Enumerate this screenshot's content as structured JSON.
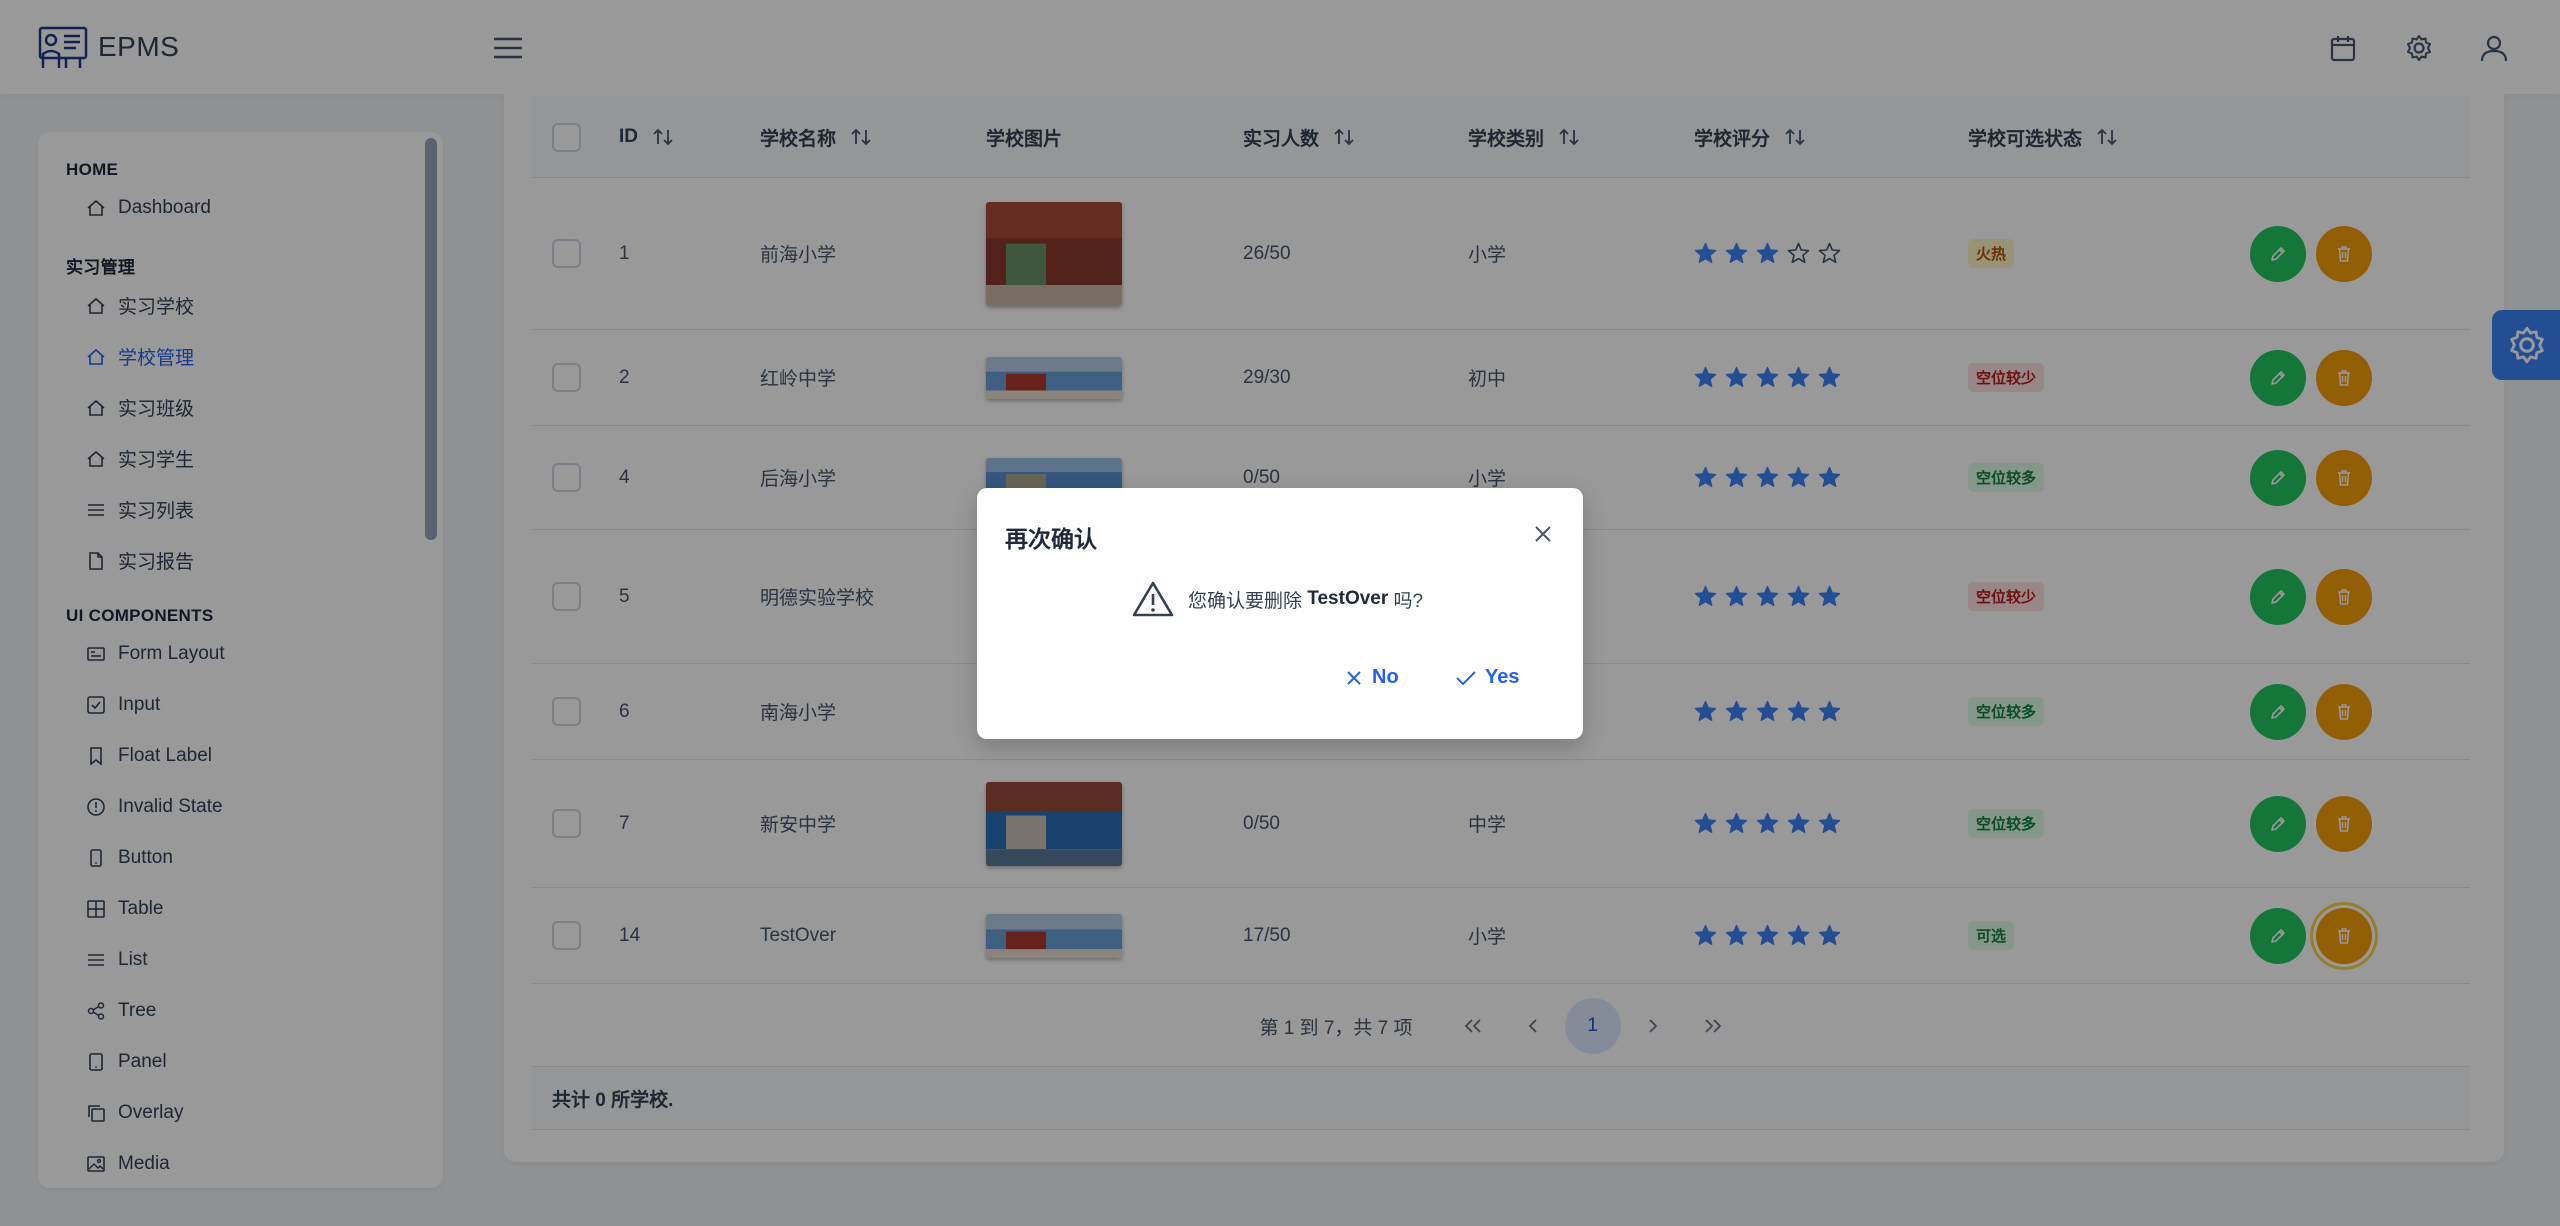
{
  "app": {
    "name": "EPMS"
  },
  "topbar_icons": [
    "calendar-icon",
    "gear-icon",
    "user-icon"
  ],
  "sidebar": {
    "sections": [
      {
        "title": "HOME",
        "items": [
          {
            "label": "Dashboard",
            "icon": "home-icon"
          }
        ]
      },
      {
        "title": "实习管理",
        "items": [
          {
            "label": "实习学校",
            "icon": "home-icon"
          },
          {
            "label": "学校管理",
            "icon": "home-icon",
            "active": true
          },
          {
            "label": "实习班级",
            "icon": "home-icon"
          },
          {
            "label": "实习学生",
            "icon": "home-icon"
          },
          {
            "label": "实习列表",
            "icon": "list-icon"
          },
          {
            "label": "实习报告",
            "icon": "file-icon"
          }
        ]
      },
      {
        "title": "UI COMPONENTS",
        "items": [
          {
            "label": "Form Layout",
            "icon": "id-card-icon"
          },
          {
            "label": "Input",
            "icon": "check-square-icon"
          },
          {
            "label": "Float Label",
            "icon": "bookmark-icon"
          },
          {
            "label": "Invalid State",
            "icon": "exclamation-circle-icon"
          },
          {
            "label": "Button",
            "icon": "mobile-icon"
          },
          {
            "label": "Table",
            "icon": "table-icon"
          },
          {
            "label": "List",
            "icon": "list-icon"
          },
          {
            "label": "Tree",
            "icon": "share-icon"
          },
          {
            "label": "Panel",
            "icon": "tablet-icon"
          },
          {
            "label": "Overlay",
            "icon": "clone-icon"
          },
          {
            "label": "Media",
            "icon": "image-icon"
          }
        ]
      }
    ]
  },
  "table": {
    "headers": {
      "id": "ID",
      "name": "学校名称",
      "image": "学校图片",
      "count": "实习人数",
      "type": "学校类别",
      "rating": "学校评分",
      "status": "学校可选状态"
    },
    "rows": [
      {
        "id": "1",
        "name": "前海小学",
        "count": "26/50",
        "type": "小学",
        "rating": 3,
        "status": "火热",
        "status_kind": "hot"
      },
      {
        "id": "2",
        "name": "红岭中学",
        "count": "29/30",
        "type": "初中",
        "rating": 5,
        "status": "空位较少",
        "status_kind": "few"
      },
      {
        "id": "4",
        "name": "后海小学",
        "count": "0/50",
        "type": "小学",
        "rating": 5,
        "status": "空位较多",
        "status_kind": "many"
      },
      {
        "id": "5",
        "name": "明德实验学校",
        "count": "",
        "type": "",
        "rating": 5,
        "status": "空位较少",
        "status_kind": "few"
      },
      {
        "id": "6",
        "name": "南海小学",
        "count": "",
        "type": "",
        "rating": 5,
        "status": "空位较多",
        "status_kind": "many"
      },
      {
        "id": "7",
        "name": "新安中学",
        "count": "0/50",
        "type": "中学",
        "rating": 5,
        "status": "空位较多",
        "status_kind": "many"
      },
      {
        "id": "14",
        "name": "TestOver",
        "count": "17/50",
        "type": "小学",
        "rating": 5,
        "status": "可选",
        "status_kind": "ok"
      }
    ]
  },
  "paginator": {
    "summary": "第 1 到 7，共 7 项",
    "current_page": "1"
  },
  "footer": {
    "summary": "共计 0 所学校."
  },
  "dialog": {
    "title": "再次确认",
    "message_prefix": "您确认要删除 ",
    "message_target": "TestOver",
    "message_suffix": " 吗?",
    "no_label": "No",
    "yes_label": "Yes"
  },
  "colors": {
    "accent": "#2563eb",
    "edit": "#22c55e",
    "delete": "#f59e0b",
    "star": "#3b82f6"
  }
}
